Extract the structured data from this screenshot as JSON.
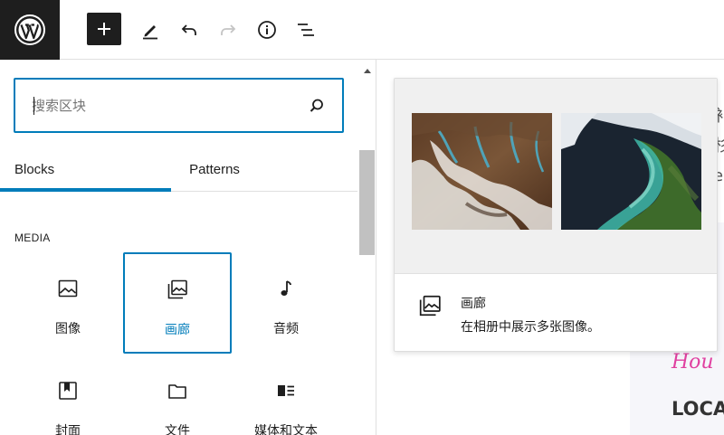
{
  "toolbar": {
    "logo_icon": "wordpress-logo",
    "add_icon": "plus-icon",
    "tools_icon": "pencil-icon",
    "undo_icon": "undo-icon",
    "redo_icon": "redo-icon",
    "info_icon": "info-icon",
    "outline_icon": "list-view-icon"
  },
  "inserter": {
    "search": {
      "placeholder": "搜索区块",
      "value": ""
    },
    "tabs": [
      {
        "label": "Blocks",
        "active": true
      },
      {
        "label": "Patterns",
        "active": false
      }
    ],
    "category": "MEDIA",
    "blocks": [
      {
        "label": "图像",
        "icon": "image-icon",
        "selected": false
      },
      {
        "label": "画廊",
        "icon": "gallery-icon",
        "selected": true
      },
      {
        "label": "音频",
        "icon": "audio-icon",
        "selected": false
      },
      {
        "label": "封面",
        "icon": "cover-icon",
        "selected": false
      },
      {
        "label": "文件",
        "icon": "file-icon",
        "selected": false
      },
      {
        "label": "媒体和文本",
        "icon": "media-text-icon",
        "selected": false
      }
    ]
  },
  "preview": {
    "title": "画廊",
    "description": "在相册中展示多张图像。",
    "icon": "gallery-icon"
  },
  "background": {
    "glyphs": [
      "衤",
      "杉",
      "es"
    ],
    "script_text": "Hou",
    "bold_text": "LOCA"
  },
  "colors": {
    "accent": "#007cba",
    "toolbar_dark": "#1e1e1e",
    "preview_bg": "#f0f0f0"
  }
}
